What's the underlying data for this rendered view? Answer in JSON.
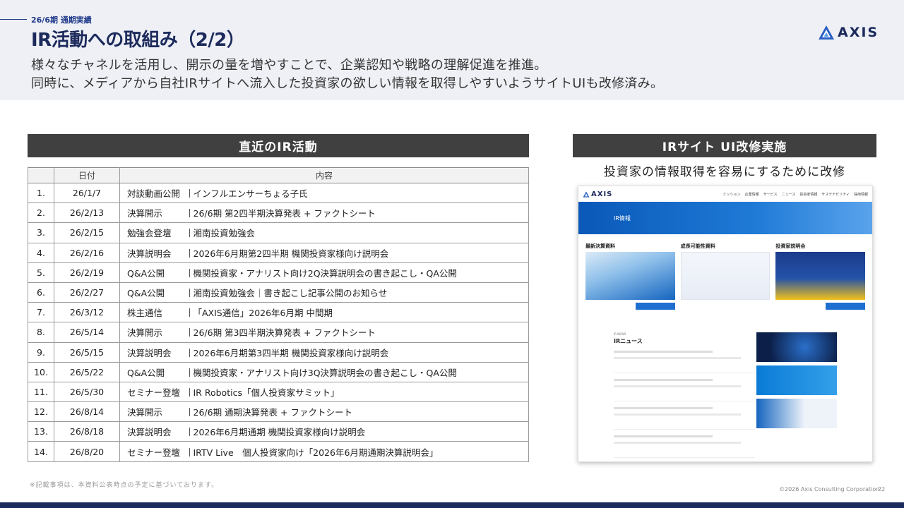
{
  "header": {
    "period": "26/6期 通期実績",
    "title": "IR活動への取組み（2/2）",
    "subtitle_line1": "様々なチャネルを活用し、開示の量を増やすことで、企業認知や戦略の理解促進を推進。",
    "subtitle_line2": "同時に、メディアから自社IRサイトへ流入した投資家の欲しい情報を取得しやすいようサイトUIも改修済み。"
  },
  "logo": {
    "text": "AXIS"
  },
  "left_section": {
    "heading": "直近のIR活動",
    "columns": {
      "date": "日付",
      "content": "内容"
    },
    "rows": [
      {
        "no": "1.",
        "date": "26/1/7",
        "category": "対談動画公開",
        "detail": "インフルエンサーちょる子氏"
      },
      {
        "no": "2.",
        "date": "26/2/13",
        "category": "決算開示",
        "detail": "26/6期 第2四半期決算発表 + ファクトシート"
      },
      {
        "no": "3.",
        "date": "26/2/15",
        "category": "勉強会登壇",
        "detail": "湘南投資勉強会"
      },
      {
        "no": "4.",
        "date": "26/2/16",
        "category": "決算説明会",
        "detail": "2026年6月期第2四半期 機関投資家様向け説明会"
      },
      {
        "no": "5.",
        "date": "26/2/19",
        "category": "Q&A公開",
        "detail": "機関投資家・アナリスト向け2Q決算説明会の書き起こし・QA公開"
      },
      {
        "no": "6.",
        "date": "26/2/27",
        "category": "Q&A公開",
        "detail": "湘南投資勉強会｜書き起こし記事公開のお知らせ"
      },
      {
        "no": "7.",
        "date": "26/3/12",
        "category": "株主通信",
        "detail": "「AXIS通信」2026年6月期 中間期"
      },
      {
        "no": "8.",
        "date": "26/5/14",
        "category": "決算開示",
        "detail": "26/6期 第3四半期決算発表 + ファクトシート"
      },
      {
        "no": "9.",
        "date": "26/5/15",
        "category": "決算説明会",
        "detail": "2026年6月期第3四半期 機関投資家様向け説明会"
      },
      {
        "no": "10.",
        "date": "26/5/22",
        "category": "Q&A公開",
        "detail": "機関投資家・アナリスト向け3Q決算説明会の書き起こし・QA公開"
      },
      {
        "no": "11.",
        "date": "26/5/30",
        "category": "セミナー登壇",
        "detail": "IR Robotics「個人投資家サミット」"
      },
      {
        "no": "12.",
        "date": "26/8/14",
        "category": "決算開示",
        "detail": "26/6期 通期決算発表 + ファクトシート"
      },
      {
        "no": "13.",
        "date": "26/8/18",
        "category": "決算説明会",
        "detail": "2026年6月期通期 機関投資家様向け説明会"
      },
      {
        "no": "14.",
        "date": "26/8/20",
        "category": "セミナー登壇",
        "detail": "IRTV Live　個人投資家向け「2026年6月期通期決算説明会」"
      }
    ]
  },
  "right_section": {
    "heading": "IRサイト UI改修実施",
    "caption": "投資家の情報取得を容易にするために改修",
    "screenshot": {
      "logo": "AXIS",
      "menu": [
        "ミッション",
        "企業情報",
        "サービス",
        "ニュース",
        "投資家情報",
        "サステナビリティ",
        "採用情報"
      ],
      "hero": "IR情報",
      "cols": [
        "最新決算資料",
        "成長可能性資料",
        "投資家説明会"
      ],
      "news_small": "IR NEWS",
      "news_title": "IRニュース"
    }
  },
  "footer": {
    "note": "※記載事項は、本資料公表時点の予定に基づいております。",
    "copyright": "©2026 Axis Consulting Corporation",
    "page": "22"
  }
}
